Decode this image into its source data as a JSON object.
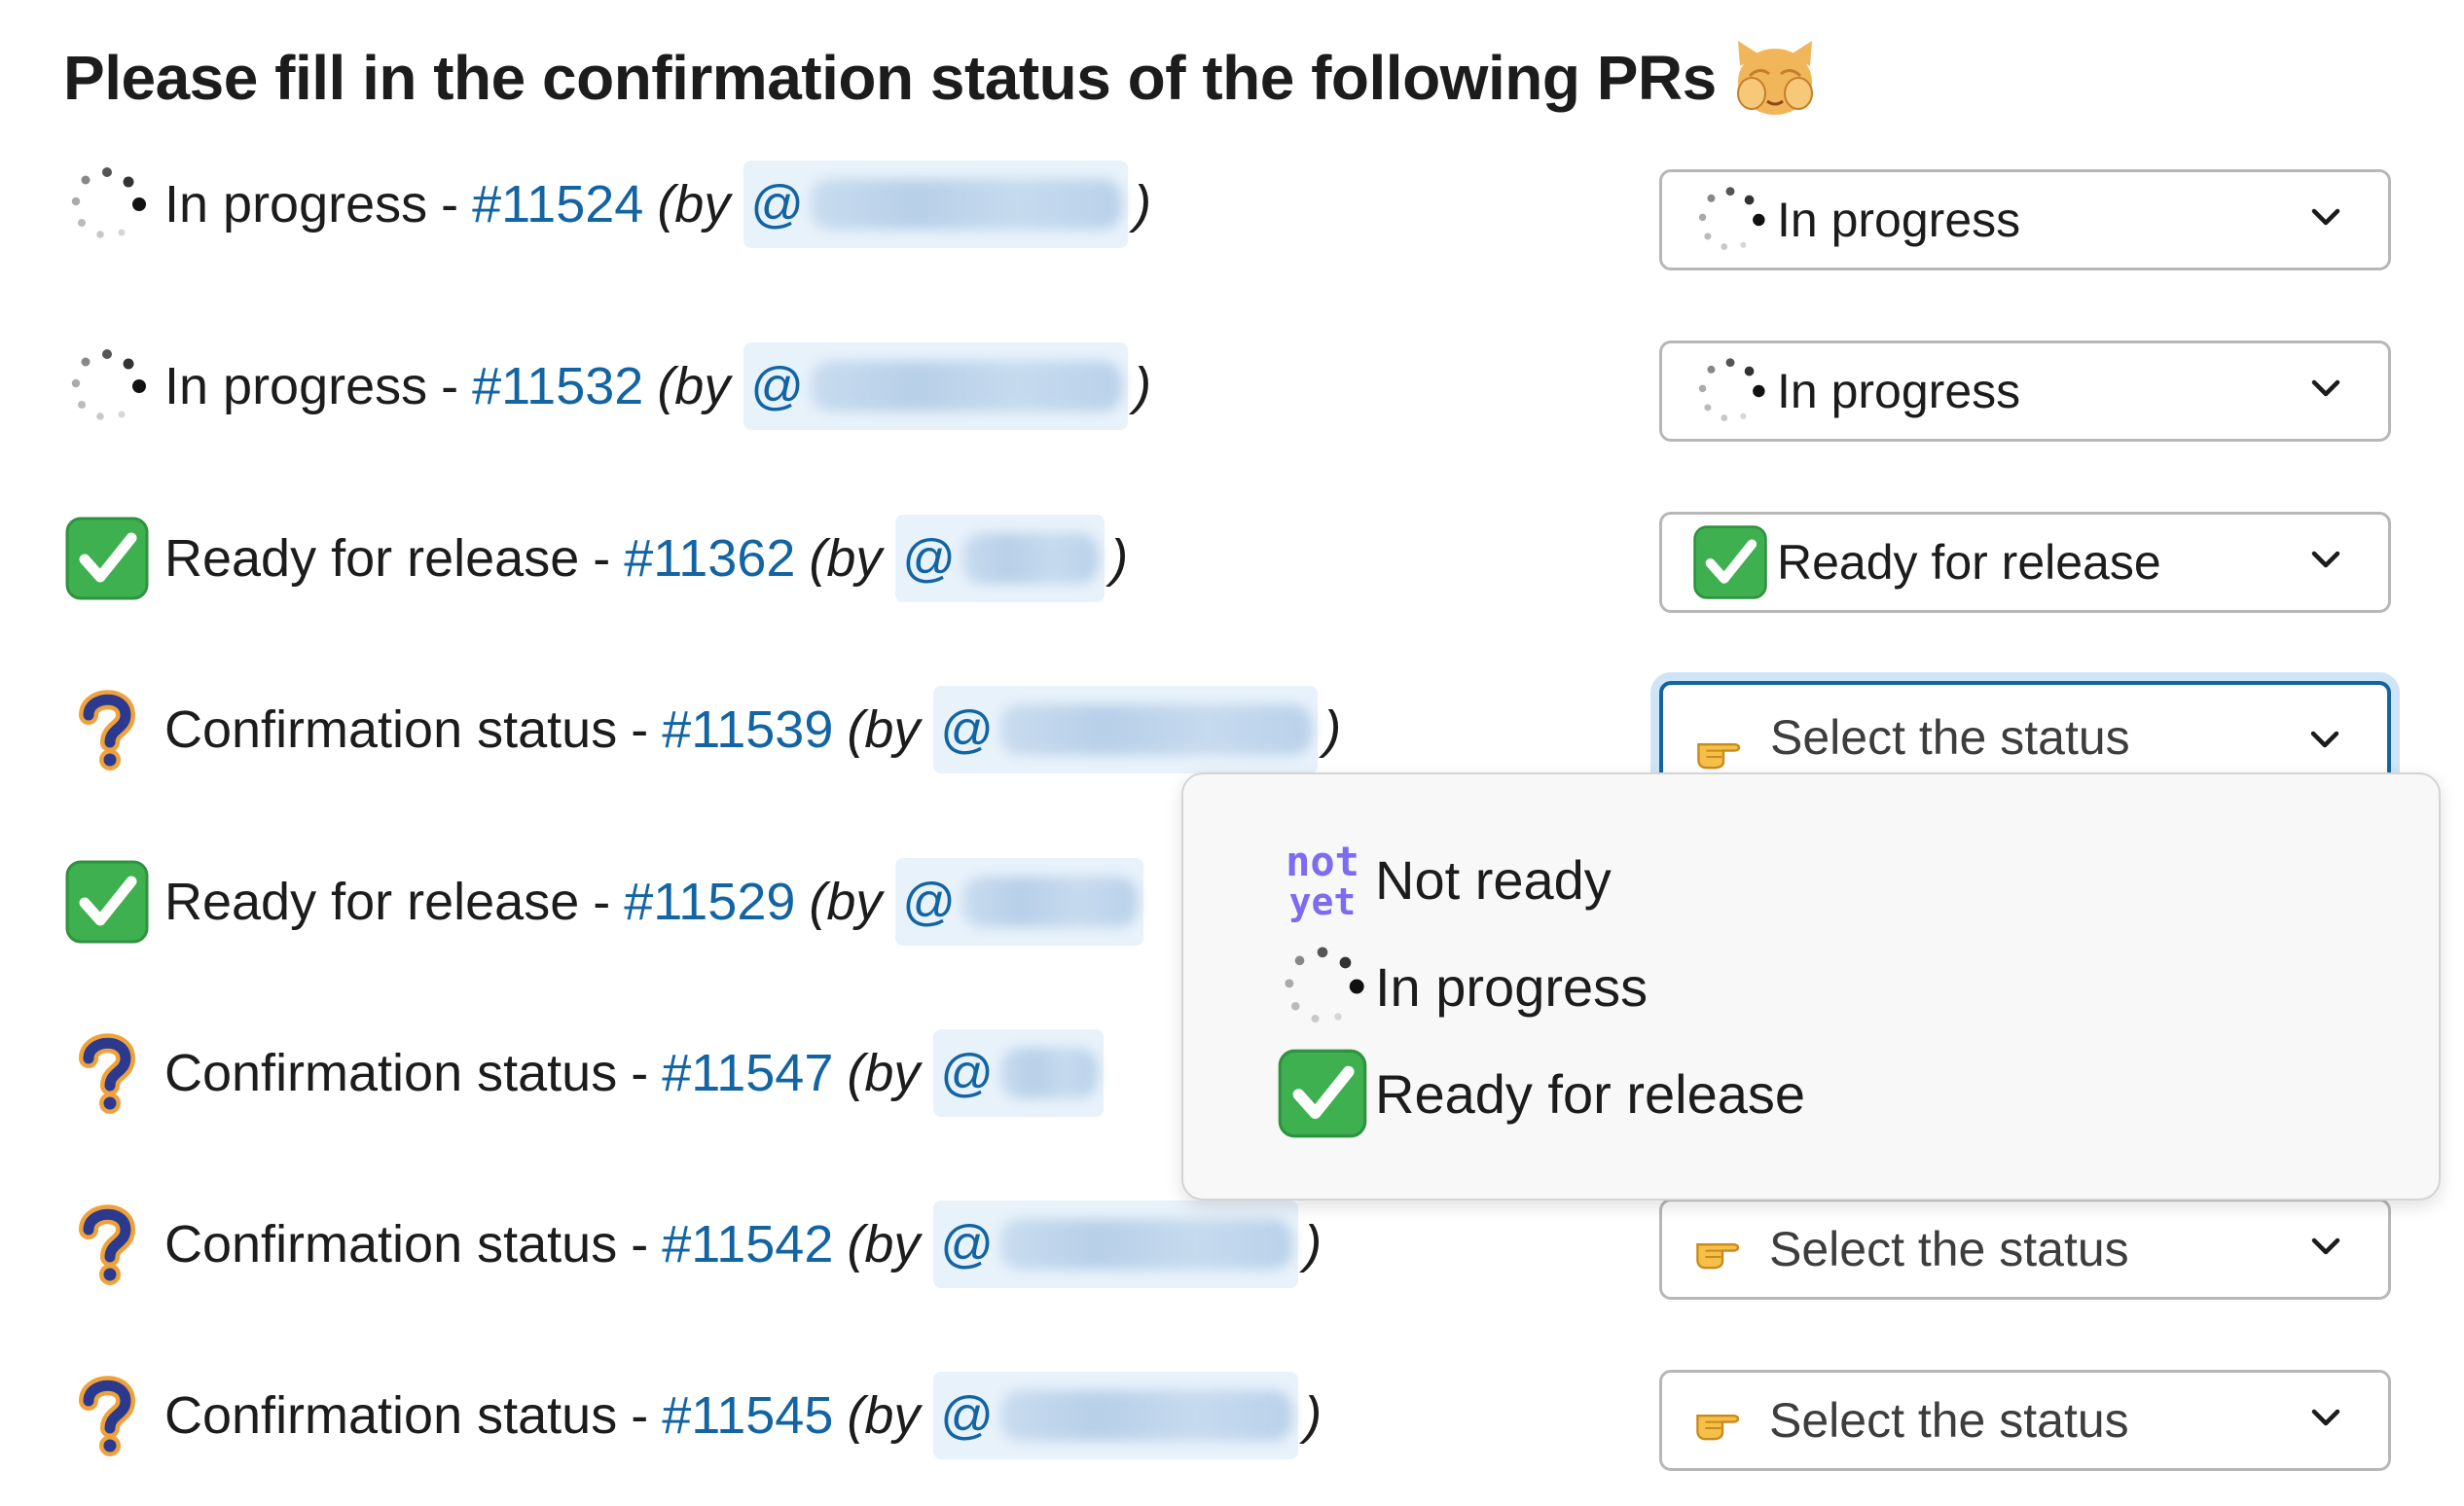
{
  "title": "Please fill in the confirmation status of the following PRs",
  "title_icon": "cat-covering-eyes-icon",
  "rows": [
    {
      "status": "In progress",
      "icon": "spinner-icon",
      "pr": "#11524",
      "by": "(by",
      "at": "@",
      "close": ")"
    },
    {
      "status": "In progress",
      "icon": "spinner-icon",
      "pr": "#11532",
      "by": "(by",
      "at": "@",
      "close": ")"
    },
    {
      "status": "Ready for release",
      "icon": "check-mark-icon",
      "pr": "#11362",
      "by": "(by",
      "at": "@",
      "close": ")"
    },
    {
      "status": "Confirmation status",
      "icon": "question-mark-icon",
      "pr": "#11539",
      "by": "(by",
      "at": "@",
      "close": ")"
    },
    {
      "status": "Ready for release",
      "icon": "check-mark-icon",
      "pr": "#11529",
      "by": "(by",
      "at": "@",
      "close": ""
    },
    {
      "status": "Confirmation status",
      "icon": "question-mark-icon",
      "pr": "#11547",
      "by": "(by",
      "at": "@",
      "close": ""
    },
    {
      "status": "Confirmation status",
      "icon": "question-mark-icon",
      "pr": "#11542",
      "by": "(by",
      "at": "@",
      "close": ")"
    },
    {
      "status": "Confirmation status",
      "icon": "question-mark-icon",
      "pr": "#11545",
      "by": "(by",
      "at": "@",
      "close": ")"
    }
  ],
  "separator": "-",
  "selects": [
    {
      "value": "In progress",
      "icon": "spinner-icon"
    },
    {
      "value": "In progress",
      "icon": "spinner-icon"
    },
    {
      "value": "Ready for release",
      "icon": "check-mark-icon"
    },
    {
      "value": "Select the status",
      "icon": "pointing-hand-icon"
    },
    {
      "value": "Select the status",
      "icon": "pointing-hand-icon"
    },
    {
      "value": "Select the status",
      "icon": "pointing-hand-icon"
    }
  ],
  "dropdown": {
    "options": [
      {
        "label": "Not ready",
        "icon": "not-yet-icon",
        "icon_text_top": "not",
        "icon_text_bottom": "yet"
      },
      {
        "label": "In progress",
        "icon": "spinner-icon"
      },
      {
        "label": "Ready for release",
        "icon": "check-mark-icon"
      }
    ]
  },
  "colors": {
    "link": "#1264a3",
    "check_green": "#3fb04f",
    "focus_blue": "#1264a3",
    "not_yet_purple": "#7d6bf0"
  }
}
